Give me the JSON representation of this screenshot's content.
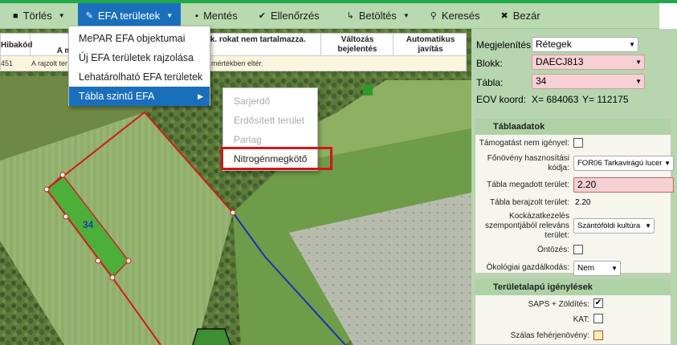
{
  "toolbar": {
    "items": [
      {
        "label": "Törlés",
        "icon": "trash-icon"
      },
      {
        "label": "EFA területek",
        "icon": "pencil-icon"
      },
      {
        "label": "Mentés",
        "icon": "save-icon"
      },
      {
        "label": "Ellenőrzés",
        "icon": "check-icon"
      },
      {
        "label": "Betöltés",
        "icon": "load-icon"
      },
      {
        "label": "Keresés",
        "icon": "search-icon"
      },
      {
        "label": "Bezár",
        "icon": "close-icon"
      }
    ]
  },
  "grid": {
    "headers": [
      "Hibakód",
      "A m",
      "ák. rokat nem tartalmazza.",
      "Változás bejelentés",
      "Automatikus javítás"
    ],
    "row": {
      "code": "451",
      "desc": "A rajzolt ter",
      "detail": "mértékben eltér."
    }
  },
  "menu": {
    "items": [
      "MePAR EFA objektumai",
      "Új EFA területek rajzolása",
      "Lehatárolható EFA területek",
      "Tábla szintű EFA"
    ]
  },
  "submenu": {
    "items": [
      "Sarjerdő",
      "Erdősített terület",
      "Parlag",
      "Nitrogénmegkötő"
    ]
  },
  "map": {
    "parcel_label": "34"
  },
  "panel": {
    "display_label": "Megjelenítés:",
    "display_value": "Rétegek",
    "block_label": "Blokk:",
    "block_value": "DAECJ813",
    "table_label": "Tábla:",
    "table_value": "34",
    "eov_label": "EOV koord:",
    "eov_x": "X= 684063",
    "eov_y": "Y= 112175",
    "section1_title": "Táblaadatok",
    "support_label": "Támogatást nem igényel:",
    "crop_label_1": "Főnövény hasznosítási",
    "crop_label_2": "kódja:",
    "crop_value": "FOR06 Tarkavirágú lucer",
    "declared_label": "Tábla megadott terület:",
    "declared_value": "2.20",
    "drawn_label": "Tábla berajzolt terület:",
    "drawn_value": "2.20",
    "risk_label_1": "Kockázatkezelés",
    "risk_label_2": "szempontjából releváns",
    "risk_label_3": "terület:",
    "risk_value": "Szántóföldi kultúra",
    "irrigation_label": "Öntözés:",
    "eco_label": "Ökológiai gazdálkodás:",
    "eco_value": "Nem",
    "section2_title": "Területalapú igénylések",
    "saps_label": "SAPS + Zöldítés:",
    "kat_label": "KAT:",
    "grass_label": "Szálas fehérjenövény:"
  },
  "colors": {
    "accent": "#1a6fbd",
    "toolbar": "#b9d9b0",
    "panel": "#b7d6af",
    "highlight": "#d0161b",
    "pink": "#f6d0d2"
  }
}
